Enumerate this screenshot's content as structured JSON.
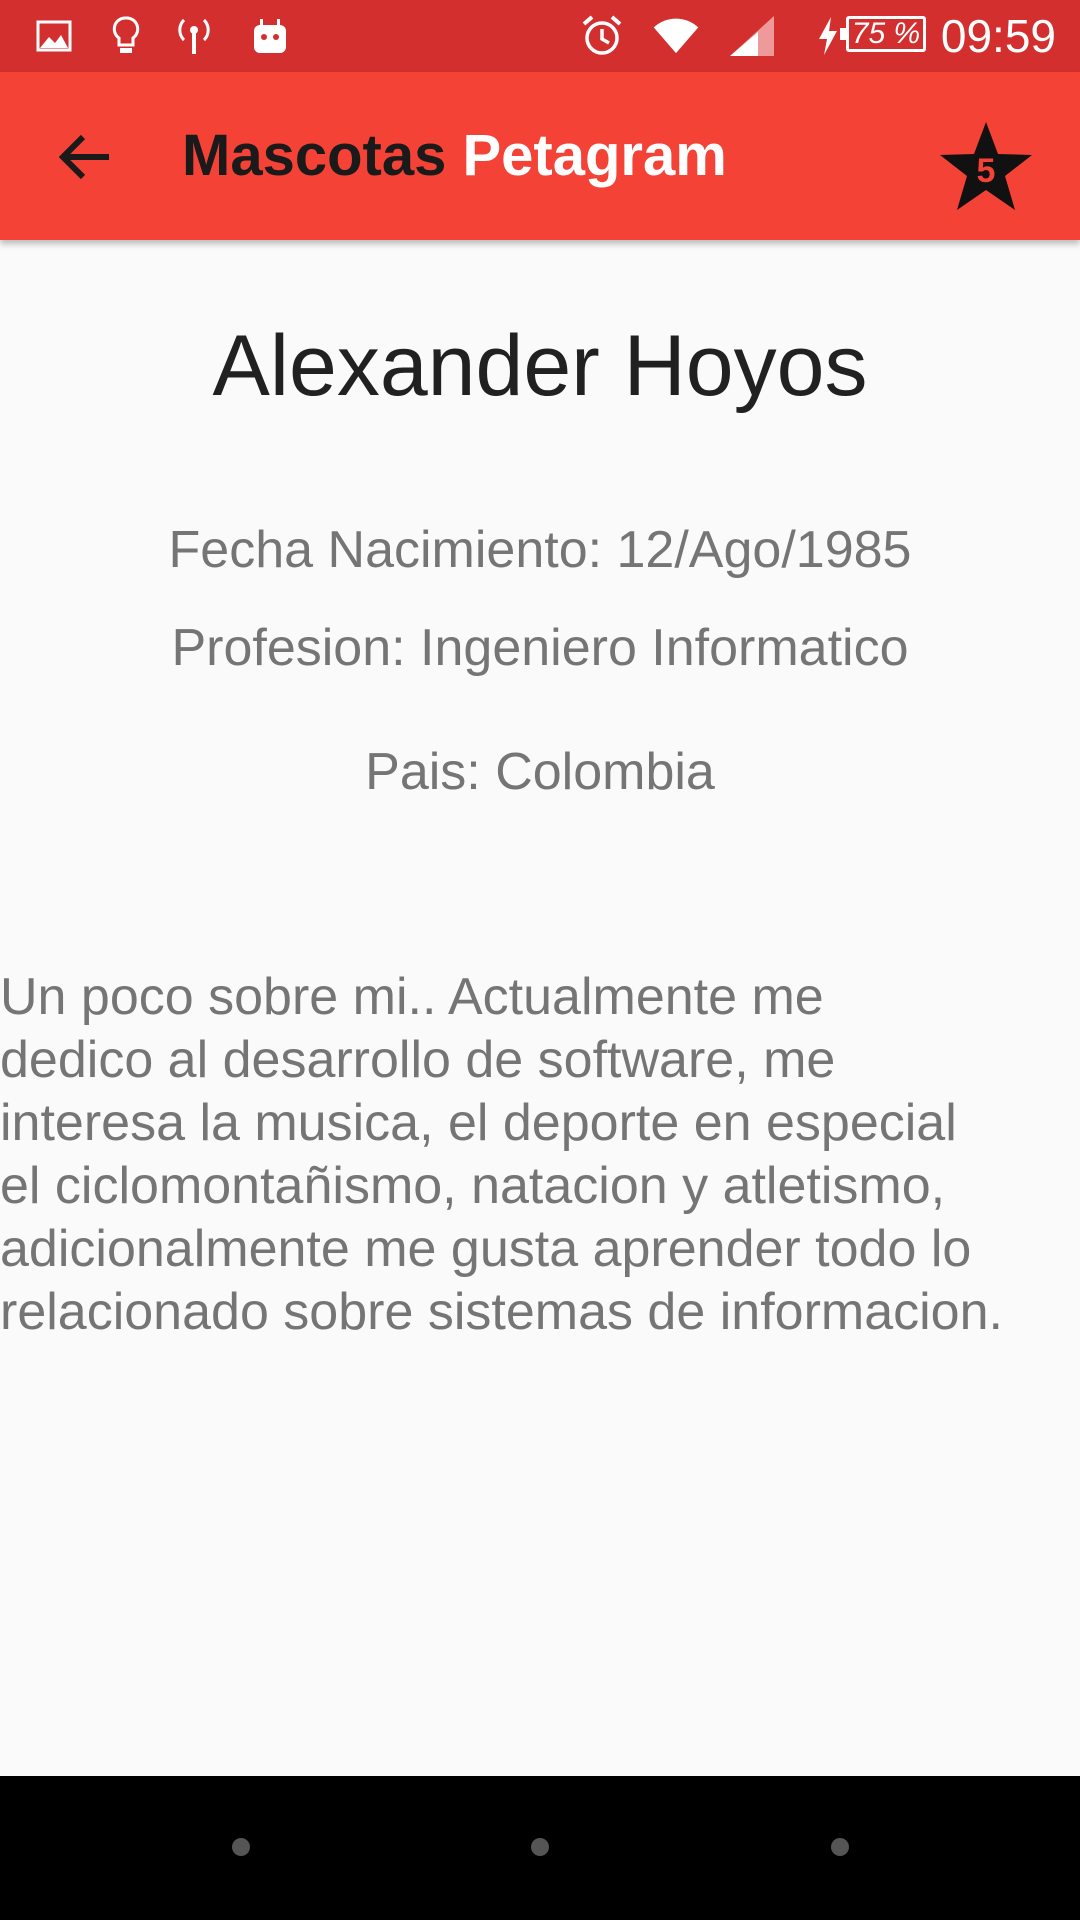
{
  "status_bar": {
    "time": "09:59",
    "battery": "75 %",
    "icons": [
      "gallery-icon",
      "lightbulb-icon",
      "hotspot-icon",
      "android-icon",
      "alarm-icon",
      "wifi-icon",
      "signal-icon",
      "charging-icon",
      "battery-icon"
    ]
  },
  "app_bar": {
    "title_part1": "Mascotas",
    "title_part2": "Petagram",
    "star_badge": "5",
    "back_icon": "arrow-back-icon",
    "star_icon": "star-icon"
  },
  "profile": {
    "name": "Alexander Hoyos",
    "birth": "Fecha Nacimiento: 12/Ago/1985",
    "profession": "Profesion: Ingeniero Informatico",
    "country": "Pais: Colombia",
    "about": "Un poco sobre mi.. Actualmente me\ndedico al desarrollo de software, me\ninteresa la musica, el deporte en especial\nel ciclomontañismo, natacion y atletismo,\nadicionalmente me gusta aprender todo lo\nrelacionado sobre sistemas de informacion."
  },
  "colors": {
    "status_bar": "#d32f2f",
    "app_bar": "#f44336",
    "background": "#fafafa",
    "nav_bar": "#000000"
  }
}
